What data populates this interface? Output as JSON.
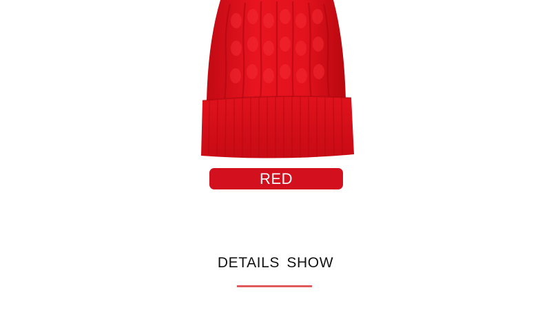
{
  "product": {
    "image_icon": "red-knit-beanie",
    "color_label": "RED",
    "accent_color": "#d2101e"
  },
  "section": {
    "title": "DETAILS SHOW",
    "underline_color": "#e05a5a"
  }
}
